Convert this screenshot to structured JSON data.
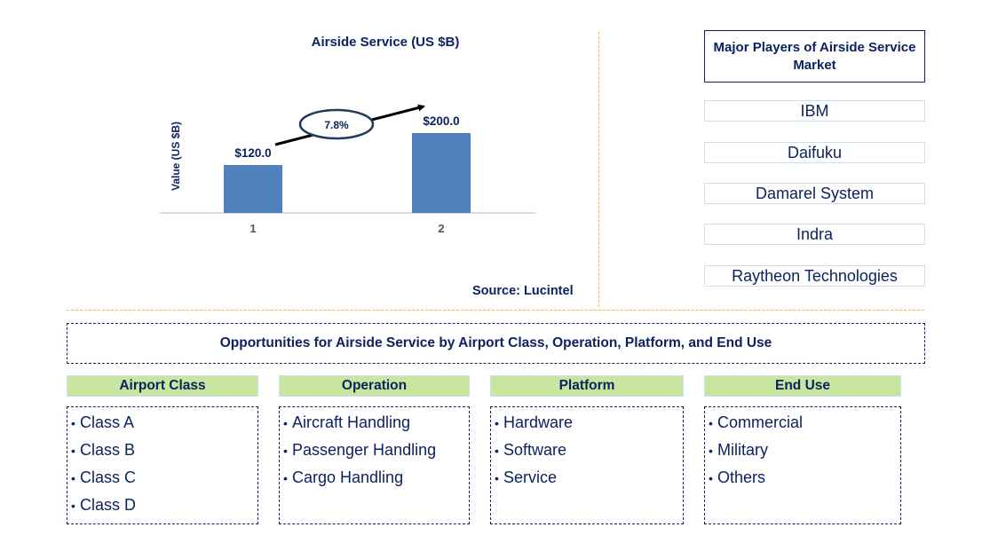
{
  "chart_data": {
    "type": "bar",
    "title": "Airside Service (US $B)",
    "xlabel": "",
    "ylabel": "Value (US $B)",
    "categories": [
      "1",
      "2"
    ],
    "values": [
      120.0,
      200.0
    ],
    "data_labels": [
      "$120.0",
      "$200.0"
    ],
    "ylim": [
      0,
      240
    ],
    "grid": false,
    "bar_color": "#4f81bd",
    "annotation": {
      "type": "cagr-arrow",
      "label": "7.8%"
    }
  },
  "source": "Source: Lucintel",
  "players": {
    "title": "Major Players of Airside Service Market",
    "items": [
      "IBM",
      "Daifuku",
      "Damarel System",
      "Indra",
      "Raytheon Technologies"
    ]
  },
  "opportunities": {
    "title": "Opportunities for Airside Service by Airport Class, Operation, Platform, and End Use",
    "bullet": "•",
    "categories": [
      {
        "name": "Airport Class",
        "items": [
          "Class A",
          "Class B",
          "Class C",
          "Class D"
        ]
      },
      {
        "name": "Operation",
        "items": [
          "Aircraft Handling",
          "Passenger Handling",
          "Cargo Handling"
        ]
      },
      {
        "name": "Platform",
        "items": [
          "Hardware",
          "Software",
          "Service"
        ]
      },
      {
        "name": "End Use",
        "items": [
          "Commercial",
          "Military",
          "Others"
        ]
      }
    ]
  },
  "colors": {
    "text": "#0d2260",
    "bar": "#4f81bd",
    "category_header": "#c8e6a0",
    "divider": "#f2bf1e"
  }
}
